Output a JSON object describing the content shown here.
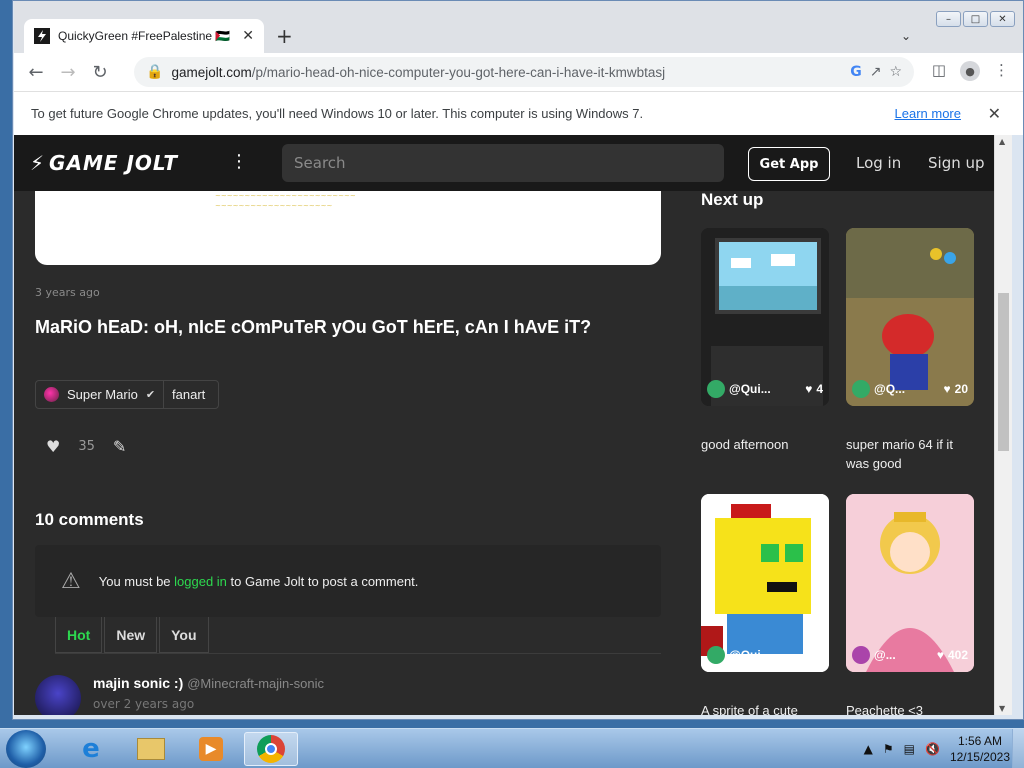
{
  "browser": {
    "tab_title": "QuickyGreen #FreePalestine 🇵🇸",
    "new_tab": "+",
    "tab_close": "✕",
    "url_domain": "gamejolt.com",
    "url_path": "/p/mario-head-oh-nice-computer-you-got-here-can-i-have-it-kmwbtasj",
    "infobar_message": "To get future Google Chrome updates, you'll need Windows 10 or later. This computer is using Windows 7.",
    "infobar_link": "Learn more",
    "window_controls": [
      "–",
      "□",
      "✕"
    ]
  },
  "site": {
    "logo_text": "GAME JOLT",
    "search_placeholder": "Search",
    "get_app": "Get App",
    "log_in": "Log in",
    "sign_up": "Sign up"
  },
  "post": {
    "time_ago": "3 years ago",
    "title": "MaRiO hEaD: oH, nIcE cOmPuTeR yOu GoT hErE, cAn I hAvE iT?",
    "community": "Super Mario",
    "tag": "fanart",
    "like_count": "35",
    "comments_heading": "10 comments",
    "notice_prefix": "You must be ",
    "notice_link": "logged in",
    "notice_suffix": " to Game Jolt to post a comment.",
    "comment_tabs": [
      "Hot",
      "New",
      "You"
    ],
    "comment": {
      "name": "majin sonic :)",
      "handle": "@Minecraft-majin-sonic",
      "time": "over 2 years ago"
    }
  },
  "next_up": {
    "heading": "Next up",
    "items": [
      {
        "user": "@Qui...",
        "likes": "4",
        "caption": "good afternoon"
      },
      {
        "user": "@Q...",
        "likes": "20",
        "caption": "super mario 64 if it was good"
      },
      {
        "user": "@Qui...",
        "likes": "5",
        "caption": "A sprite of a cute"
      },
      {
        "user": "@...",
        "likes": "402",
        "caption": "Peachette <3"
      }
    ]
  },
  "taskbar": {
    "time": "1:56 AM",
    "date": "12/15/2023"
  },
  "colors": {
    "gj_green": "#2dd84f",
    "page_bg": "#2b2b2b",
    "nav_bg": "#191919"
  }
}
